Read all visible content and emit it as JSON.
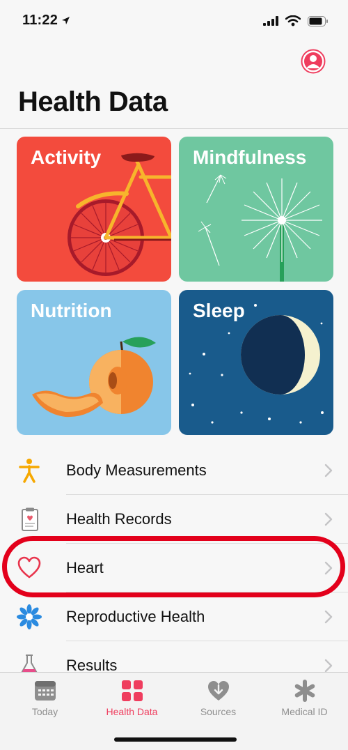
{
  "status_bar": {
    "time": "11:22"
  },
  "header": {
    "title": "Health Data"
  },
  "tiles": [
    {
      "label": "Activity",
      "color": "#f34b3d"
    },
    {
      "label": "Mindfulness",
      "color": "#6fc7a0"
    },
    {
      "label": "Nutrition",
      "color": "#87c6e9"
    },
    {
      "label": "Sleep",
      "color": "#195b8c"
    }
  ],
  "list": {
    "items": [
      {
        "label": "Body Measurements",
        "icon": "figure-icon"
      },
      {
        "label": "Health Records",
        "icon": "clipboard-icon"
      },
      {
        "label": "Heart",
        "icon": "heart-icon",
        "highlighted": true
      },
      {
        "label": "Reproductive Health",
        "icon": "flower-icon"
      },
      {
        "label": "Results",
        "icon": "flask-icon"
      }
    ]
  },
  "tab_bar": {
    "active": "Health Data",
    "tabs": [
      {
        "label": "Today",
        "icon": "calendar-icon"
      },
      {
        "label": "Health Data",
        "icon": "grid-icon"
      },
      {
        "label": "Sources",
        "icon": "download-heart-icon"
      },
      {
        "label": "Medical ID",
        "icon": "asterisk-icon"
      }
    ]
  },
  "colors": {
    "accent": "#ef3d5e",
    "highlight": "#e3001b"
  }
}
